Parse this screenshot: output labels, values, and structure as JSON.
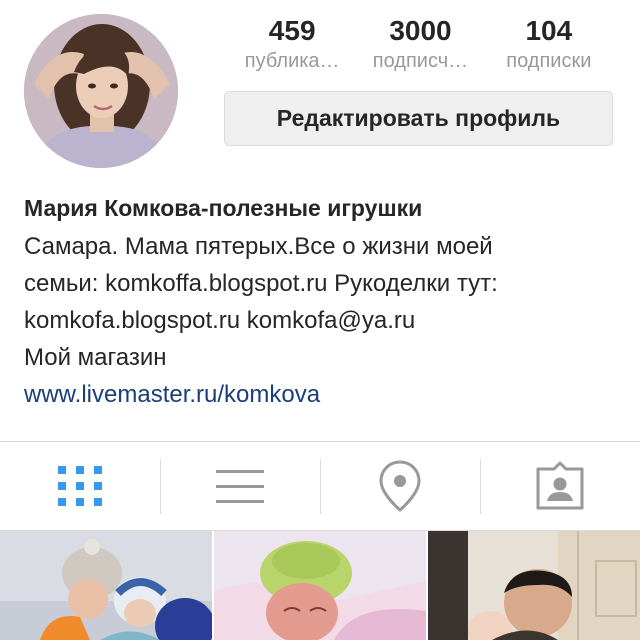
{
  "profile": {
    "posts_count": "459",
    "posts_label": "публика…",
    "followers_count": "3000",
    "followers_label": "подписч…",
    "following_count": "104",
    "following_label": "подписки",
    "edit_button_label": "Редактировать профиль"
  },
  "bio": {
    "name": "Мария Комкова-полезные игрушки",
    "line1": "Самара. Мама пятерых.Все о жизни моей",
    "line2": "семьи: komkoffa.blogspot.ru Рукоделки тут:",
    "line3": "komkofa.blogspot.ru komkofa@ya.ru",
    "shop": "Мой магазин",
    "link": "www.livemaster.ru/komkova"
  },
  "tabs": [
    {
      "icon": "grid-icon",
      "active": true
    },
    {
      "icon": "list-icon",
      "active": false
    },
    {
      "icon": "location-pin-icon",
      "active": false
    },
    {
      "icon": "tagged-photos-icon",
      "active": false
    }
  ],
  "colors": {
    "active_tab": "#3897f0",
    "inactive_tab": "#999999",
    "link": "#1b3e79",
    "button_bg": "#efefef"
  }
}
